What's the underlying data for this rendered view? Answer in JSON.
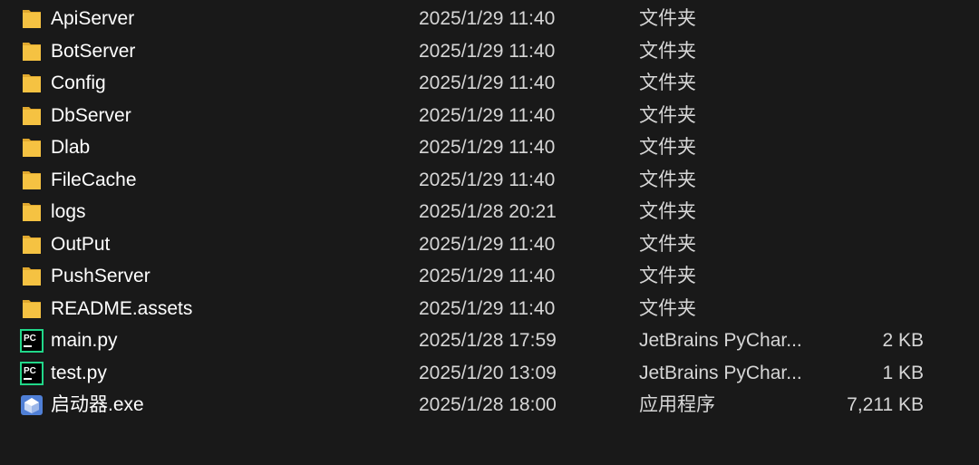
{
  "files": [
    {
      "name": "ApiServer",
      "date": "2025/1/29 11:40",
      "type": "文件夹",
      "size": "",
      "icon": "folder-icon"
    },
    {
      "name": "BotServer",
      "date": "2025/1/29 11:40",
      "type": "文件夹",
      "size": "",
      "icon": "folder-icon"
    },
    {
      "name": "Config",
      "date": "2025/1/29 11:40",
      "type": "文件夹",
      "size": "",
      "icon": "folder-icon"
    },
    {
      "name": "DbServer",
      "date": "2025/1/29 11:40",
      "type": "文件夹",
      "size": "",
      "icon": "folder-icon"
    },
    {
      "name": "Dlab",
      "date": "2025/1/29 11:40",
      "type": "文件夹",
      "size": "",
      "icon": "folder-icon"
    },
    {
      "name": "FileCache",
      "date": "2025/1/29 11:40",
      "type": "文件夹",
      "size": "",
      "icon": "folder-icon"
    },
    {
      "name": "logs",
      "date": "2025/1/28 20:21",
      "type": "文件夹",
      "size": "",
      "icon": "folder-icon"
    },
    {
      "name": "OutPut",
      "date": "2025/1/29 11:40",
      "type": "文件夹",
      "size": "",
      "icon": "folder-icon"
    },
    {
      "name": "PushServer",
      "date": "2025/1/29 11:40",
      "type": "文件夹",
      "size": "",
      "icon": "folder-icon"
    },
    {
      "name": "README.assets",
      "date": "2025/1/29 11:40",
      "type": "文件夹",
      "size": "",
      "icon": "folder-icon"
    },
    {
      "name": "main.py",
      "date": "2025/1/28 17:59",
      "type": "JetBrains PyChar...",
      "size": "2 KB",
      "icon": "pycharm-file-icon"
    },
    {
      "name": "test.py",
      "date": "2025/1/20 13:09",
      "type": "JetBrains PyChar...",
      "size": "1 KB",
      "icon": "pycharm-file-icon"
    },
    {
      "name": "启动器.exe",
      "date": "2025/1/28 18:00",
      "type": "应用程序",
      "size": "7,211 KB",
      "icon": "exe-app-icon"
    }
  ],
  "colors": {
    "background": "#191919",
    "folder": "#f5c242",
    "folder_tab": "#e0a82e",
    "pycharm_green": "#21d789",
    "exe_blue": "#4f7fd6"
  }
}
